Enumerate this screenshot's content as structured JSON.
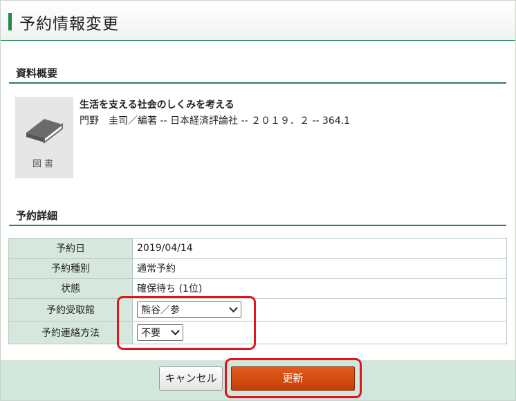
{
  "header": {
    "title": "予約情報変更"
  },
  "summary": {
    "section_title": "資料概要",
    "thumbnail_caption": "図書",
    "book_title": "生活を支える社会のしくみを考える",
    "book_meta": "門野　圭司／編著 -- 日本経済評論社 -- ２０１９．２ -- 364.1"
  },
  "details": {
    "section_title": "予約詳細",
    "rows": [
      {
        "label": "予約日",
        "value": "2019/04/14"
      },
      {
        "label": "予約種別",
        "value": "通常予約"
      },
      {
        "label": "状態",
        "value": "確保待ち (1位)"
      },
      {
        "label": "予約受取館",
        "value": "熊谷／参"
      },
      {
        "label": "予約連絡方法",
        "value": "不要"
      }
    ]
  },
  "actions": {
    "cancel_label": "キャンセル",
    "update_label": "更新"
  },
  "colors": {
    "accent_green": "#1f8a4c",
    "label_bg": "#d6e8dd",
    "update_button": "#d14d12",
    "highlight": "#e0141e"
  }
}
